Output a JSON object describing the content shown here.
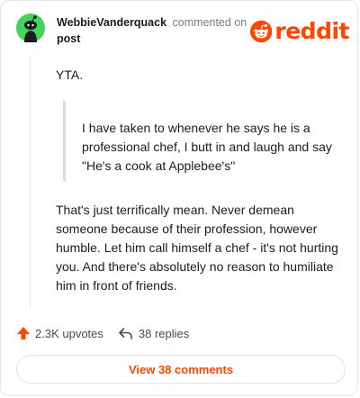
{
  "header": {
    "username": "WebbieVanderquack",
    "action_text": "commented on",
    "post_link": "post"
  },
  "brand": {
    "logo_text": "reddit",
    "color": "#ff4500"
  },
  "comment": {
    "paragraph1": "YTA.",
    "quote": "I have taken to whenever he says he is a professional chef, I butt in and laugh and say \"He's a cook at Applebee's\"",
    "paragraph2": "That's just terrifically mean. Never demean someone because of their profession, however humble. Let him call himself a chef - it's not hurting you. And there's absolutely no reason to humiliate him in front of friends."
  },
  "actions": {
    "upvotes": "2.3K upvotes",
    "replies": "38 replies"
  },
  "footer": {
    "view_comments": "View 38 comments"
  },
  "colors": {
    "accent": "#ff4500",
    "avatar": "#46d160",
    "text": "#1c1c1c",
    "muted": "#7c7c7c"
  },
  "icons": {
    "avatar": "snoo-avatar-icon",
    "logo": "snoo-logo-icon",
    "upvote": "upvote-arrow-icon",
    "reply": "reply-arrow-icon"
  }
}
